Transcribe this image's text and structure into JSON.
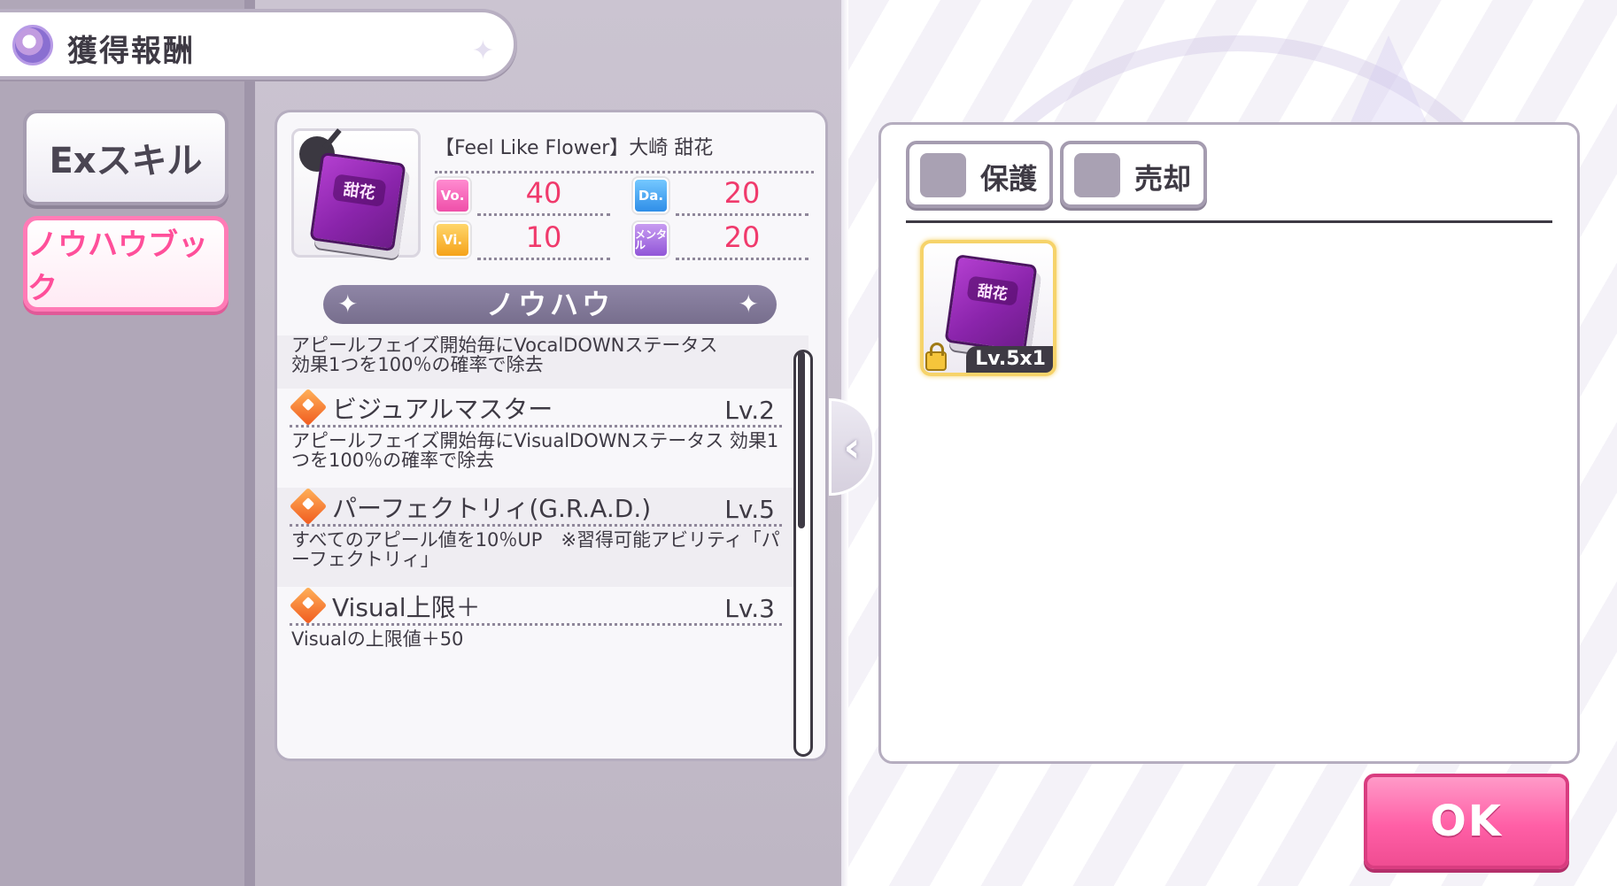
{
  "header": {
    "title": "獲得報酬"
  },
  "tabs": {
    "exskill": "Exスキル",
    "knowhow": "ノウハウブック"
  },
  "card": {
    "name": "【Feel Like Flower】大崎 甜花",
    "book_label": "甜花",
    "stats": {
      "vo": {
        "label": "Vo.",
        "value": "40"
      },
      "da": {
        "label": "Da.",
        "value": "20"
      },
      "vi": {
        "label": "Vi.",
        "value": "10"
      },
      "me": {
        "label": "メンタル",
        "value": "20"
      }
    },
    "section_title": "ノウハウ",
    "abilities_partial_desc": "アピールフェイズ開始毎にVocalDOWNステータス\n効果1つを100％の確率で除去",
    "abilities": [
      {
        "name": "ビジュアルマスター",
        "level": "Lv.2",
        "desc": "アピールフェイズ開始毎にVisualDOWNステータス 効果1つを100％の確率で除去"
      },
      {
        "name": "パーフェクトリィ(G.R.A.D.)",
        "level": "Lv.5",
        "desc": "すべてのアピール値を10％UP　※習得可能アビリティ「パーフェクトリィ」"
      },
      {
        "name": "Visual上限＋",
        "level": "Lv.3",
        "desc": "Visualの上限値＋50"
      }
    ]
  },
  "right_panel": {
    "protect_label": "保護",
    "sell_label": "売却",
    "item": {
      "book_label": "甜花",
      "level_text": "Lv.5x1"
    }
  },
  "ok_label": "OK",
  "colors": {
    "accent_pink": "#ff5fa6",
    "stat_value": "#f03a6c",
    "panel_border": "#b5adbf"
  }
}
